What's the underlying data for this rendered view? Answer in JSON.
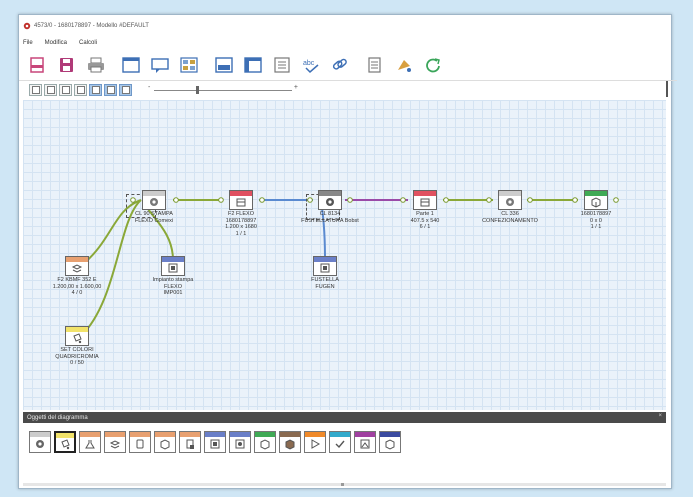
{
  "window": {
    "title": "4573/0 - 1680178897 - Modello #DEFAULT"
  },
  "menu": [
    {
      "label": "File"
    },
    {
      "label": "Modifica"
    },
    {
      "label": "Calcoli"
    }
  ],
  "toolbar": {
    "buttons": [
      {
        "icon": "new-document-icon",
        "color": "#c8467a"
      },
      {
        "icon": "save-icon",
        "color": "#b03a78"
      },
      {
        "icon": "print-icon",
        "color": "#777777"
      },
      {
        "icon": "window-icon",
        "color": "#3d6fb5"
      },
      {
        "icon": "chat-icon",
        "color": "#3d6fb5"
      },
      {
        "icon": "image-grid-icon",
        "color": "#3d6fb5"
      },
      {
        "icon": "panel-icon",
        "color": "#3d6fb5"
      },
      {
        "icon": "table-icon",
        "color": "#3d6fb5"
      },
      {
        "icon": "list-window-icon",
        "color": "#3d6fb5"
      },
      {
        "icon": "copy-icon",
        "color": "#777777"
      },
      {
        "icon": "spellcheck-icon",
        "color": "#3d6fb5"
      },
      {
        "icon": "link-icon",
        "color": "#3d6fb5"
      },
      {
        "icon": "document-list-icon",
        "color": "#777777"
      },
      {
        "icon": "paint-icon",
        "color": "#c08a2a"
      },
      {
        "icon": "refresh-icon",
        "color": "#3aa55a"
      }
    ]
  },
  "zoom": {
    "minus": "-",
    "plus": "+",
    "level": 0.3
  },
  "diagram": {
    "nodes": [
      {
        "id": "cl90",
        "label": "CL 90 STAMPA\nFLEXO Comexi",
        "header_color": "#cccccc",
        "icon": "gear-icon"
      },
      {
        "id": "f2flexo",
        "label": "F2 FLEXO\n1680178897\n1.200 x 1680\n1 / 1",
        "header_color": "#e05060",
        "icon": "package-icon"
      },
      {
        "id": "cl8134",
        "label": "CL 8134\nFUSTELLATURA Bobst",
        "header_color": "#888888",
        "icon": "gear-icon"
      },
      {
        "id": "parte1",
        "label": "Parte 1\n407.5 x 540\n6 / 1",
        "header_color": "#e05060",
        "icon": "package-icon"
      },
      {
        "id": "cl336",
        "label": "CL 336\nCONFEZIONAMENTO",
        "header_color": "#cccccc",
        "icon": "gear-icon"
      },
      {
        "id": "final",
        "label": "1680178897\n0 x 0\n1 / 1",
        "header_color": "#3faa55",
        "icon": "box-icon"
      },
      {
        "id": "f2kbmf",
        "label": "F2 KBMF 352 E\n1.200,00 x 1.600,00\n4 / 0",
        "header_color": "#e8a070",
        "icon": "stack-icon"
      },
      {
        "id": "impianto",
        "label": "Impianto stampa\nFLEXO\nIMP001",
        "header_color": "#6a7fc8",
        "icon": "plate-icon"
      },
      {
        "id": "fustella",
        "label": "FUSTELLA\nFUGEN",
        "header_color": "#6a7fc8",
        "icon": "plate-icon"
      },
      {
        "id": "setcolori",
        "label": "SET COLORI\nQUADRICROMIA\n0 / 50",
        "header_color": "#f2e36a",
        "icon": "paint-bucket-icon"
      }
    ]
  },
  "panel": {
    "title": "Oggetti del diagramma",
    "close": "×",
    "palette": [
      {
        "icon": "gear-icon",
        "header_color": "#cccccc"
      },
      {
        "icon": "paint-bucket-icon",
        "header_color": "#f2e36a",
        "selected": true
      },
      {
        "icon": "flask-icon",
        "header_color": "#e8a070"
      },
      {
        "icon": "stack-icon",
        "header_color": "#e8a070"
      },
      {
        "icon": "roll-icon",
        "header_color": "#e8a070"
      },
      {
        "icon": "package-icon",
        "header_color": "#e8a070"
      },
      {
        "icon": "document-icon",
        "header_color": "#e8a070"
      },
      {
        "icon": "plate-icon",
        "header_color": "#6a7fc8"
      },
      {
        "icon": "plate-icon",
        "header_color": "#6a7fc8"
      },
      {
        "icon": "box-icon",
        "header_color": "#3faa55"
      },
      {
        "icon": "box-icon",
        "header_color": "#8a6a50"
      },
      {
        "icon": "play-icon",
        "header_color": "#f08a2a"
      },
      {
        "icon": "check-icon",
        "header_color": "#33aacc"
      },
      {
        "icon": "image-icon",
        "header_color": "#a040a0"
      },
      {
        "icon": "box-icon",
        "header_color": "#3a4aa0"
      }
    ]
  }
}
